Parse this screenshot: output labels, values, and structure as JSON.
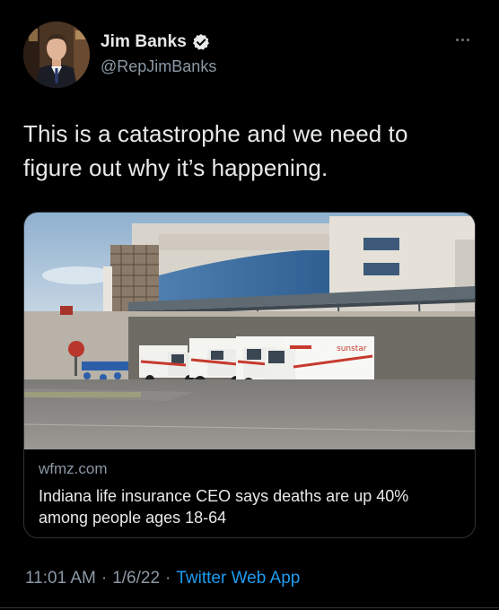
{
  "author": {
    "display_name": "Jim Banks",
    "handle": "@RepJimBanks",
    "verified": true,
    "avatar_icon": "profile-photo"
  },
  "tweet": {
    "text": "This is a catastrophe and we need to figure out why it’s happening."
  },
  "link_card": {
    "domain": "wfmz.com",
    "title": "Indiana life insurance CEO says deaths are up 40% among people ages 18-64",
    "image_icon": "hospital-ambulance-bay-photo",
    "ambulance_text": "sunstar"
  },
  "meta": {
    "time": "11:01 AM",
    "separator": "·",
    "date": "1/6/22",
    "source": "Twitter Web App"
  },
  "colors": {
    "background": "#000000",
    "primary_text": "#e7e9ea",
    "secondary_text": "#8b98a5",
    "link_blue": "#1d9bf0",
    "border": "#2f3336"
  }
}
